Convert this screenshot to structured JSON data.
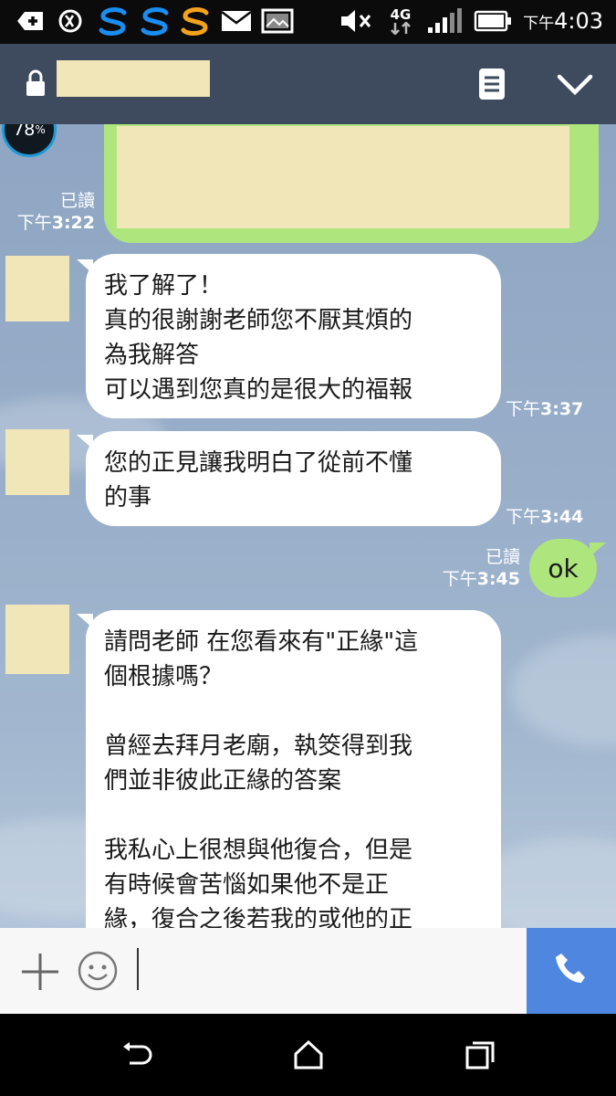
{
  "status_bar": {
    "time_prefix": "下午",
    "time": "4:03",
    "network_label": "4G",
    "icons": [
      "plus-icon",
      "sync-icon",
      "s-app-icon",
      "s-app-icon",
      "s-app-icon",
      "mail-icon",
      "image-icon",
      "mute-icon",
      "signal-icon",
      "battery-icon"
    ]
  },
  "header": {
    "icons": [
      "lock-icon",
      "notes-icon",
      "chevron-down-icon"
    ]
  },
  "widget": {
    "battery_percent": "78",
    "percent_sign": "%"
  },
  "messages": [
    {
      "side": "out",
      "read_label": "已讀",
      "time_prefix": "下午",
      "time": "3:22",
      "content": ""
    },
    {
      "side": "in",
      "text": "我了解了！\n真的很謝謝老師您不厭其煩的\n為我解答\n可以遇到您真的是很大的福報",
      "time_prefix": "下午",
      "time": "3:37"
    },
    {
      "side": "in",
      "text": "您的正見讓我明白了從前不懂\n的事",
      "time_prefix": "下午",
      "time": "3:44"
    },
    {
      "side": "out",
      "text": "ok",
      "read_label": "已讀",
      "time_prefix": "下午",
      "time": "3:45"
    },
    {
      "side": "in",
      "text": "請問老師  在您看來有\"正緣\"這\n個根據嗎？\n\n曾經去拜月老廟，執筊得到我\n們並非彼此正緣的答案\n\n我私心上很想與他復合，但是\n有時候會苦惱如果他不是正\n緣，復合之後若我的或他的正"
    }
  ],
  "input_bar": {
    "icons": [
      "plus-icon",
      "emoji-icon",
      "phone-icon"
    ],
    "value": ""
  },
  "nav_bar": {
    "icons": [
      "back-icon",
      "home-icon",
      "recents-icon"
    ]
  },
  "colors": {
    "header": "#3e4a5e",
    "out_bubble": "#aee67d",
    "in_bubble": "#ffffff",
    "call_button": "#4f87e0"
  }
}
